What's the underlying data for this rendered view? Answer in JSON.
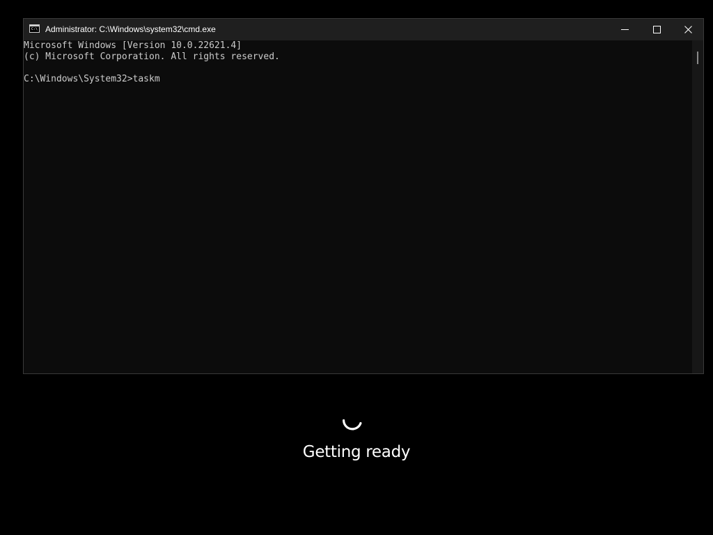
{
  "window": {
    "title": "Administrator: C:\\Windows\\system32\\cmd.exe",
    "icon": "console-icon",
    "icon_text": "C:\\",
    "controls": [
      "minimize-icon",
      "maximize-icon",
      "close-icon"
    ]
  },
  "console": {
    "lines": [
      "Microsoft Windows [Version 10.0.22621.4]",
      "(c) Microsoft Corporation. All rights reserved.",
      "",
      "C:\\Windows\\System32>taskm"
    ],
    "text_color": "#cccccc",
    "background_color": "#0c0c0c"
  },
  "overlay": {
    "status": "Getting ready",
    "spinner_icon": "loading-spinner-icon",
    "background_color": "#000000"
  }
}
